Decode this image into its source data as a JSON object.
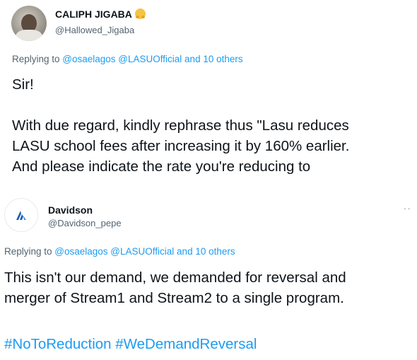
{
  "tweet1": {
    "author_name": "CALIPH JIGABA",
    "author_emoji": "hugging-face-icon",
    "author_handle": "@Hallowed_Jigaba",
    "replying_prefix": "Replying to ",
    "replying_users": "@osaelagos @LASUOfficial",
    "replying_suffix": " and 10 others",
    "lines": [
      "Sir!",
      "",
      "With due regard, kindly rephrase thus \"Lasu reduces",
      "LASU school fees after increasing it by 160% earlier.",
      "And please indicate the rate you're reducing to"
    ]
  },
  "tweet2": {
    "author_name": "Davidson",
    "author_handle": "@Davidson_pepe",
    "more_icon": "more-options-icon",
    "replying_prefix": "Replying to ",
    "replying_users": "@osaelagos @LASUOfficial",
    "replying_suffix": " and 10 others",
    "lines": [
      "This isn't our demand, we demanded for reversal and",
      "merger of Stream1 and Stream2 to a single program."
    ],
    "hashtags": "#NoToReduction #WeDemandReversal"
  },
  "colors": {
    "text": "#0f1419",
    "secondary": "#536471",
    "link": "#1d9bf0"
  }
}
